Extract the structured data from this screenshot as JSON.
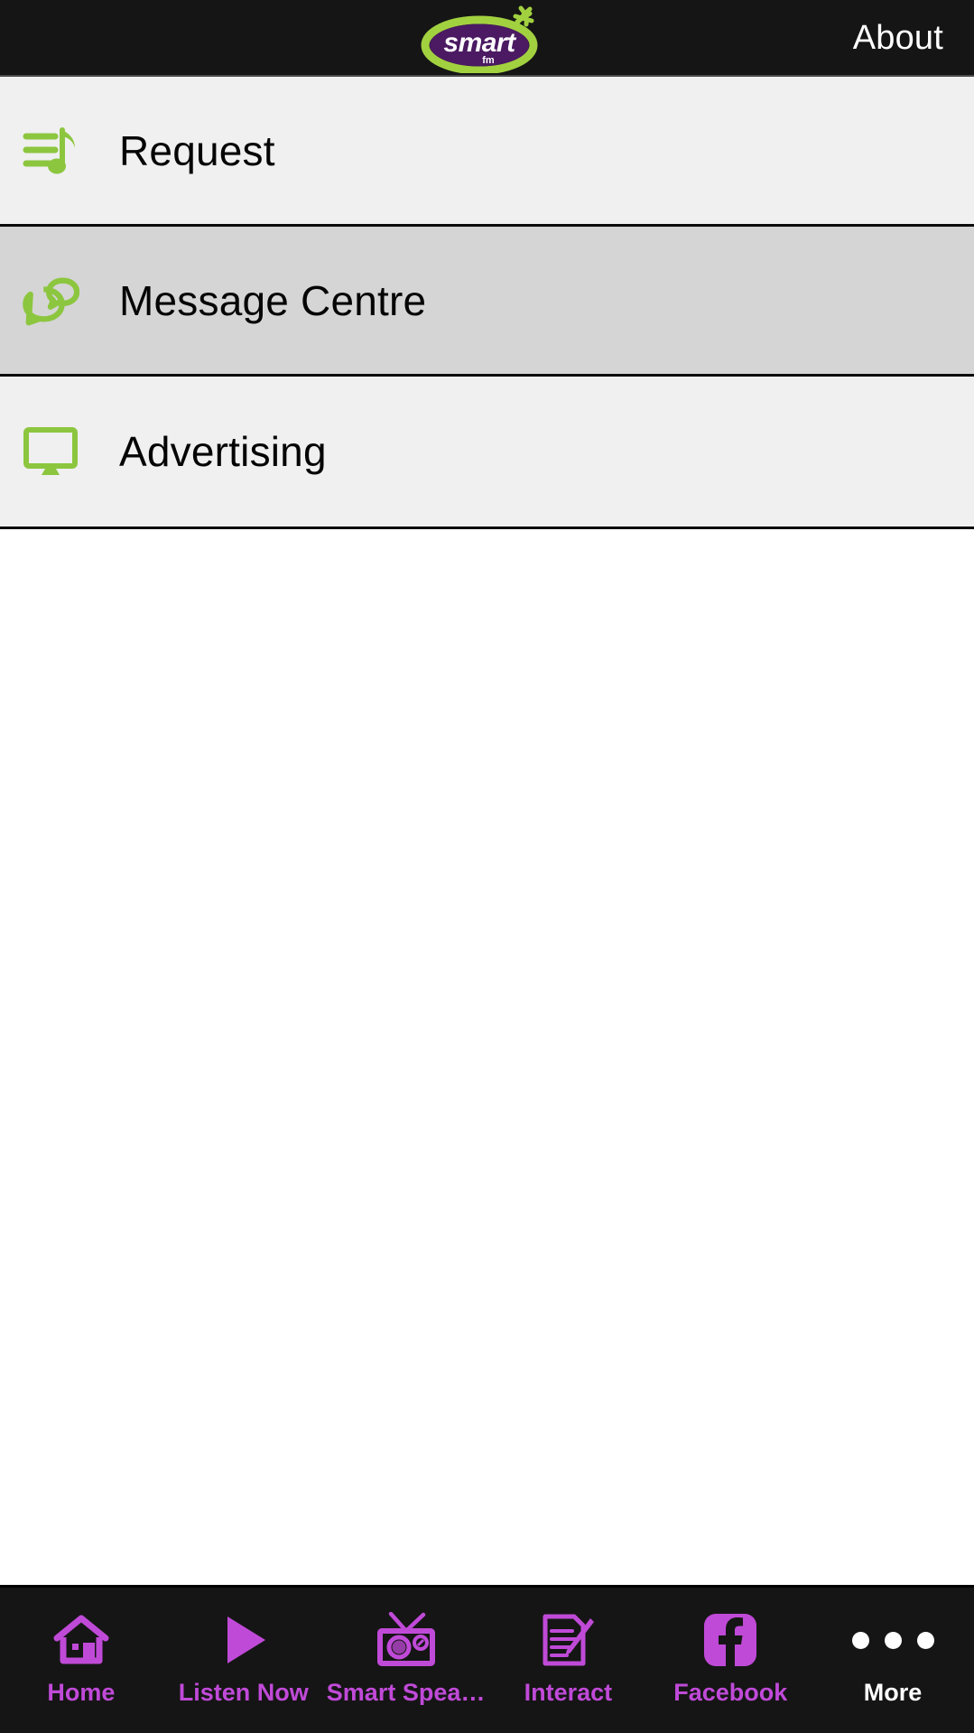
{
  "header": {
    "logo": {
      "name": "smart-fm-logo",
      "wordmark": "smart",
      "subtext": "fm",
      "oval_color": "#4b1a62",
      "ring_color": "#a2d140",
      "text_color": "#ffffff"
    },
    "about_label": "About"
  },
  "menu": {
    "items": [
      {
        "id": "request",
        "label": "Request",
        "icon": "music-playlist-icon",
        "selected": false
      },
      {
        "id": "message-centre",
        "label": "Message Centre",
        "icon": "speech-bubbles-icon",
        "selected": true
      },
      {
        "id": "advertising",
        "label": "Advertising",
        "icon": "monitor-icon",
        "selected": false
      }
    ],
    "icon_color": "#8cc63f",
    "row_bg": "#f0f0f0",
    "row_selected_bg": "#d5d5d5",
    "label_color": "#050505"
  },
  "tabbar": {
    "accent_color": "#c04ad8",
    "active_color": "#ffffff",
    "background": "#151515",
    "tabs": [
      {
        "id": "home",
        "label": "Home",
        "icon": "home-icon",
        "active": false
      },
      {
        "id": "listen-now",
        "label": "Listen Now",
        "icon": "play-icon",
        "active": false
      },
      {
        "id": "smart-speaker",
        "label": "Smart Spea…",
        "icon": "radio-icon",
        "active": false
      },
      {
        "id": "interact",
        "label": "Interact",
        "icon": "note-edit-icon",
        "active": false
      },
      {
        "id": "facebook",
        "label": "Facebook",
        "icon": "facebook-icon",
        "active": false
      },
      {
        "id": "more",
        "label": "More",
        "icon": "ellipsis-icon",
        "active": true
      }
    ]
  }
}
